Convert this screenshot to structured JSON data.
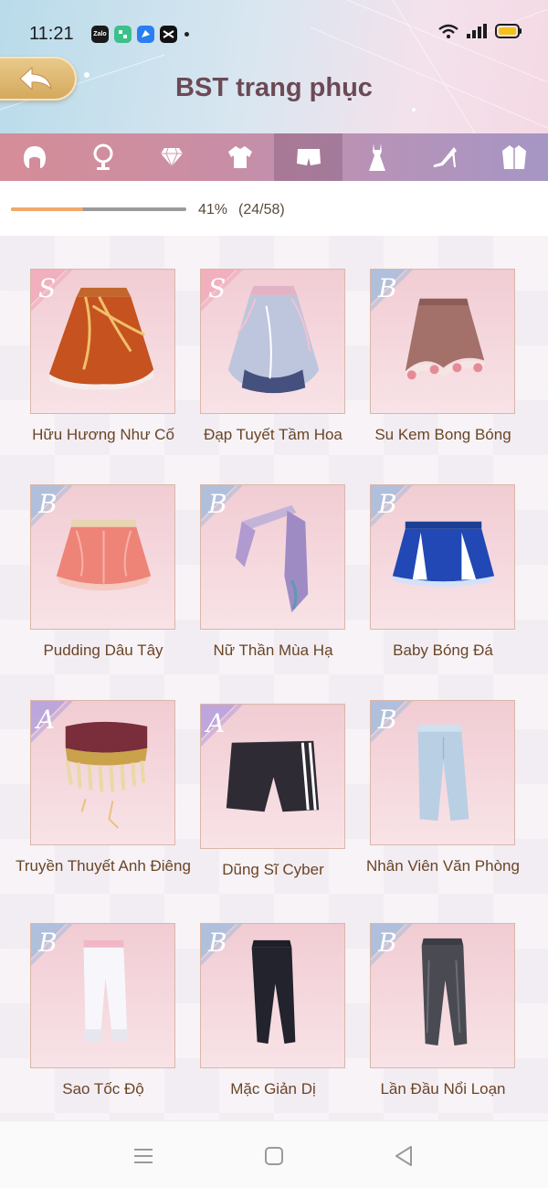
{
  "status_bar": {
    "time": "11:21",
    "apps": [
      {
        "icon": "zalo-icon",
        "label": "Zalo",
        "color": "#1a1a1a"
      },
      {
        "icon": "shop-app-icon",
        "label": "",
        "color": "#3cc08a"
      },
      {
        "icon": "messenger-app-icon",
        "label": "",
        "color": "#2a7ef2"
      },
      {
        "icon": "capcut-icon",
        "label": "",
        "color": "#111111"
      }
    ],
    "battery_color": "#f2c21a"
  },
  "header": {
    "title": "BST trang phục",
    "back_icon": "back-arrow-icon"
  },
  "tabs": [
    {
      "icon": "hair-icon",
      "active": false
    },
    {
      "icon": "mirror-icon",
      "active": false
    },
    {
      "icon": "diamond-icon",
      "active": false
    },
    {
      "icon": "top-icon",
      "active": false
    },
    {
      "icon": "bottoms-icon",
      "active": true
    },
    {
      "icon": "dress-icon",
      "active": false
    },
    {
      "icon": "high-heel-icon",
      "active": false
    },
    {
      "icon": "coat-icon",
      "active": false
    }
  ],
  "progress": {
    "percent_label": "41%",
    "count_label": "(24/58)",
    "fraction": 0.41
  },
  "items": [
    {
      "name": "Hữu Hương Như Cố",
      "rank": "S"
    },
    {
      "name": "Đạp Tuyết Tầm Hoa",
      "rank": "S"
    },
    {
      "name": "Su Kem Bong Bóng",
      "rank": "B"
    },
    {
      "name": "Pudding Dâu Tây",
      "rank": "B"
    },
    {
      "name": "Nữ Thần Mùa Hạ",
      "rank": "B"
    },
    {
      "name": "Baby Bóng Đá",
      "rank": "B"
    },
    {
      "name": "Truyền Thuyết Anh Điêng",
      "rank": "A"
    },
    {
      "name": "Dũng Sĩ Cyber",
      "rank": "A"
    },
    {
      "name": "Nhân Viên Văn Phòng",
      "rank": "B"
    },
    {
      "name": "Sao Tốc Độ",
      "rank": "B"
    },
    {
      "name": "Mặc Giản Dị",
      "rank": "B"
    },
    {
      "name": "Lần Đầu Nổi Loạn",
      "rank": "B"
    }
  ],
  "rank_colors": {
    "S": "#f2a9b8",
    "A": "#b7a2dc",
    "B": "#a9bedb"
  },
  "nav": {
    "icons": [
      "menu-icon",
      "home-icon",
      "back-icon"
    ]
  }
}
